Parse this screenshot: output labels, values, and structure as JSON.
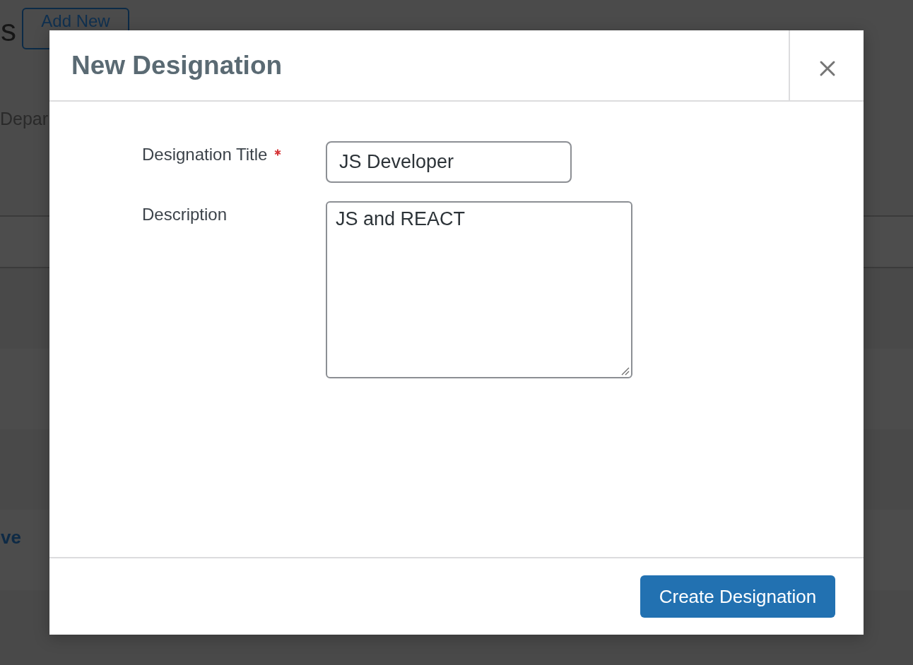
{
  "background": {
    "page_title": "s",
    "add_button": "Add New",
    "filter_text": "Depar",
    "row_text": "ve"
  },
  "dialog": {
    "title": "New Designation",
    "fields": [
      {
        "kind": "text",
        "label": "Designation Title",
        "required": true,
        "value": "JS Developer"
      },
      {
        "kind": "textarea",
        "label": "Description",
        "required": false,
        "value": "JS and REACT"
      }
    ],
    "submit_button": "Create Designation"
  }
}
